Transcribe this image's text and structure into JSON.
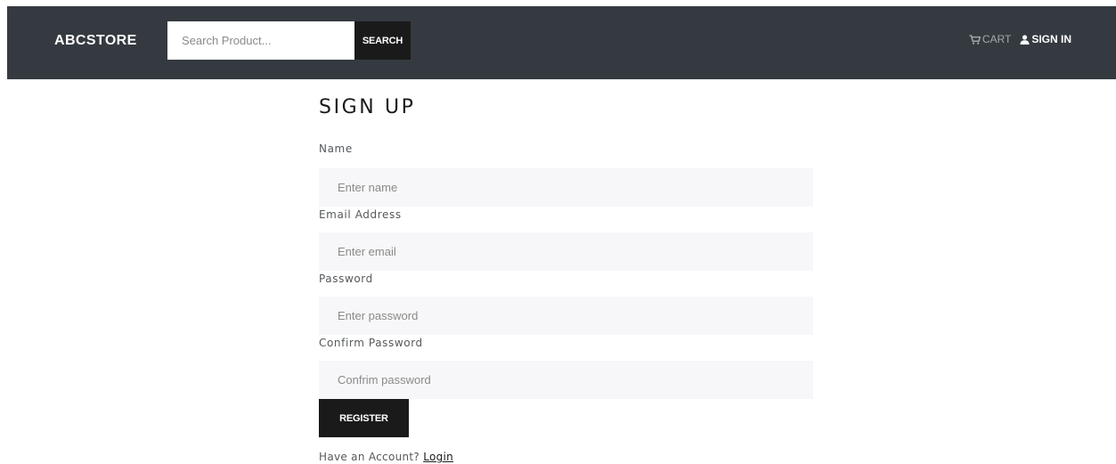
{
  "navbar": {
    "brand": "ABCSTORE",
    "search": {
      "placeholder": "Search Product...",
      "value": "",
      "button_label": "SEARCH"
    },
    "links": {
      "cart": {
        "label": "CART",
        "icon": "cart-icon"
      },
      "sign_in": {
        "label": "SIGN IN",
        "icon": "user-icon"
      }
    }
  },
  "form": {
    "title": "SIGN UP",
    "fields": {
      "name": {
        "label": "Name",
        "placeholder": "Enter name",
        "value": ""
      },
      "email": {
        "label": "Email Address",
        "placeholder": "Enter email",
        "value": ""
      },
      "password": {
        "label": "Password",
        "placeholder": "Enter password",
        "value": ""
      },
      "confirm_password": {
        "label": "Confirm Password",
        "placeholder": "Confrim password",
        "value": ""
      }
    },
    "register_label": "REGISTER",
    "footer": {
      "prompt": "Have an Account?",
      "login_label": "Login"
    }
  },
  "colors": {
    "navbar_bg": "#343a40",
    "button_bg": "#1a1a1a",
    "input_bg": "#f7f7f9",
    "text": "#55595c"
  }
}
